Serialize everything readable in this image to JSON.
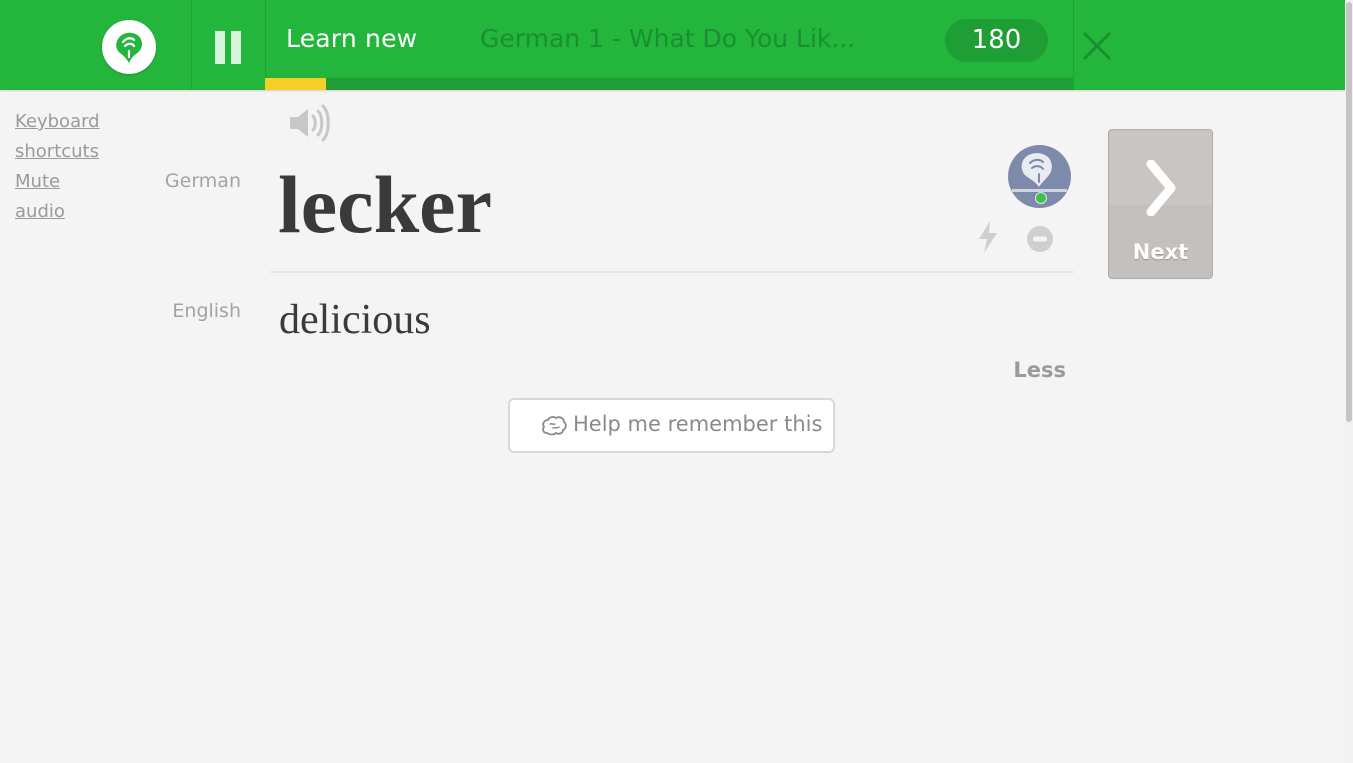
{
  "header": {
    "mode_title": "Learn new",
    "course_title": "German 1 - What Do You Lik...",
    "score": "180",
    "progress_fraction": 0.075,
    "colors": {
      "bar": "#24b53d",
      "progress": "#f4d027"
    }
  },
  "sidebar": {
    "links": [
      "Keyboard shortcuts",
      "Mute audio"
    ],
    "keyboard_line1": "Keyboard",
    "keyboard_line2": "shortcuts",
    "mute_line1": "Mute",
    "mute_line2": "audio"
  },
  "card": {
    "source_language": "German",
    "word": "lecker",
    "target_language": "English",
    "translation": "delicious",
    "less_label": "Less",
    "help_label": "Help me remember this"
  },
  "next_button": {
    "label": "Next"
  },
  "icons": {
    "logo": "memrise-logo-icon",
    "pause": "pause-icon",
    "close": "close-icon",
    "audio": "speaker-icon",
    "avatar": "mem-avatar-icon",
    "difficult": "lightning-icon",
    "ignore": "minus-circle-icon",
    "next": "chevron-right-icon",
    "help": "brain-icon"
  }
}
